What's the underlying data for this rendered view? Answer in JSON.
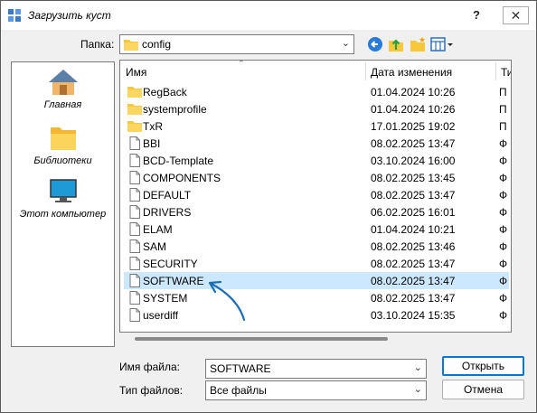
{
  "window": {
    "title": "Загрузить куст",
    "help": "?",
    "close": "✕"
  },
  "toolbar": {
    "folder_label": "Папка:",
    "folder_value": "config"
  },
  "places": [
    {
      "label": "Главная",
      "icon": "home-icon"
    },
    {
      "label": "Библиотеки",
      "icon": "libraries-folder-icon"
    },
    {
      "label": "Этот компьютер",
      "icon": "computer-icon"
    }
  ],
  "columns": {
    "name": "Имя",
    "date": "Дата изменения",
    "type": "Ти"
  },
  "files": [
    {
      "name": "RegBack",
      "date": "01.04.2024 10:26",
      "type": "П",
      "kind": "folder"
    },
    {
      "name": "systemprofile",
      "date": "01.04.2024 10:26",
      "type": "П",
      "kind": "folder"
    },
    {
      "name": "TxR",
      "date": "17.01.2025 19:02",
      "type": "П",
      "kind": "folder"
    },
    {
      "name": "BBI",
      "date": "08.02.2025 13:47",
      "type": "Ф",
      "kind": "file"
    },
    {
      "name": "BCD-Template",
      "date": "03.10.2024 16:00",
      "type": "Ф",
      "kind": "file"
    },
    {
      "name": "COMPONENTS",
      "date": "08.02.2025 13:45",
      "type": "Ф",
      "kind": "file"
    },
    {
      "name": "DEFAULT",
      "date": "08.02.2025 13:47",
      "type": "Ф",
      "kind": "file"
    },
    {
      "name": "DRIVERS",
      "date": "06.02.2025 16:01",
      "type": "Ф",
      "kind": "file"
    },
    {
      "name": "ELAM",
      "date": "01.04.2024 10:21",
      "type": "Ф",
      "kind": "file"
    },
    {
      "name": "SAM",
      "date": "08.02.2025 13:46",
      "type": "Ф",
      "kind": "file"
    },
    {
      "name": "SECURITY",
      "date": "08.02.2025 13:47",
      "type": "Ф",
      "kind": "file"
    },
    {
      "name": "SOFTWARE",
      "date": "08.02.2025 13:47",
      "type": "Ф",
      "kind": "file",
      "selected": true
    },
    {
      "name": "SYSTEM",
      "date": "08.02.2025 13:47",
      "type": "Ф",
      "kind": "file"
    },
    {
      "name": "userdiff",
      "date": "03.10.2024 15:35",
      "type": "Ф",
      "kind": "file"
    }
  ],
  "form": {
    "filename_label": "Имя файла:",
    "filename_value": "SOFTWARE",
    "filetype_label": "Тип файлов:",
    "filetype_value": "Все файлы"
  },
  "buttons": {
    "open": "Открыть",
    "cancel": "Отмена"
  },
  "colors": {
    "accent": "#0078d7",
    "selection": "#cce8ff",
    "folder": "#f8c83c",
    "arrow": "#1e6eb4"
  }
}
